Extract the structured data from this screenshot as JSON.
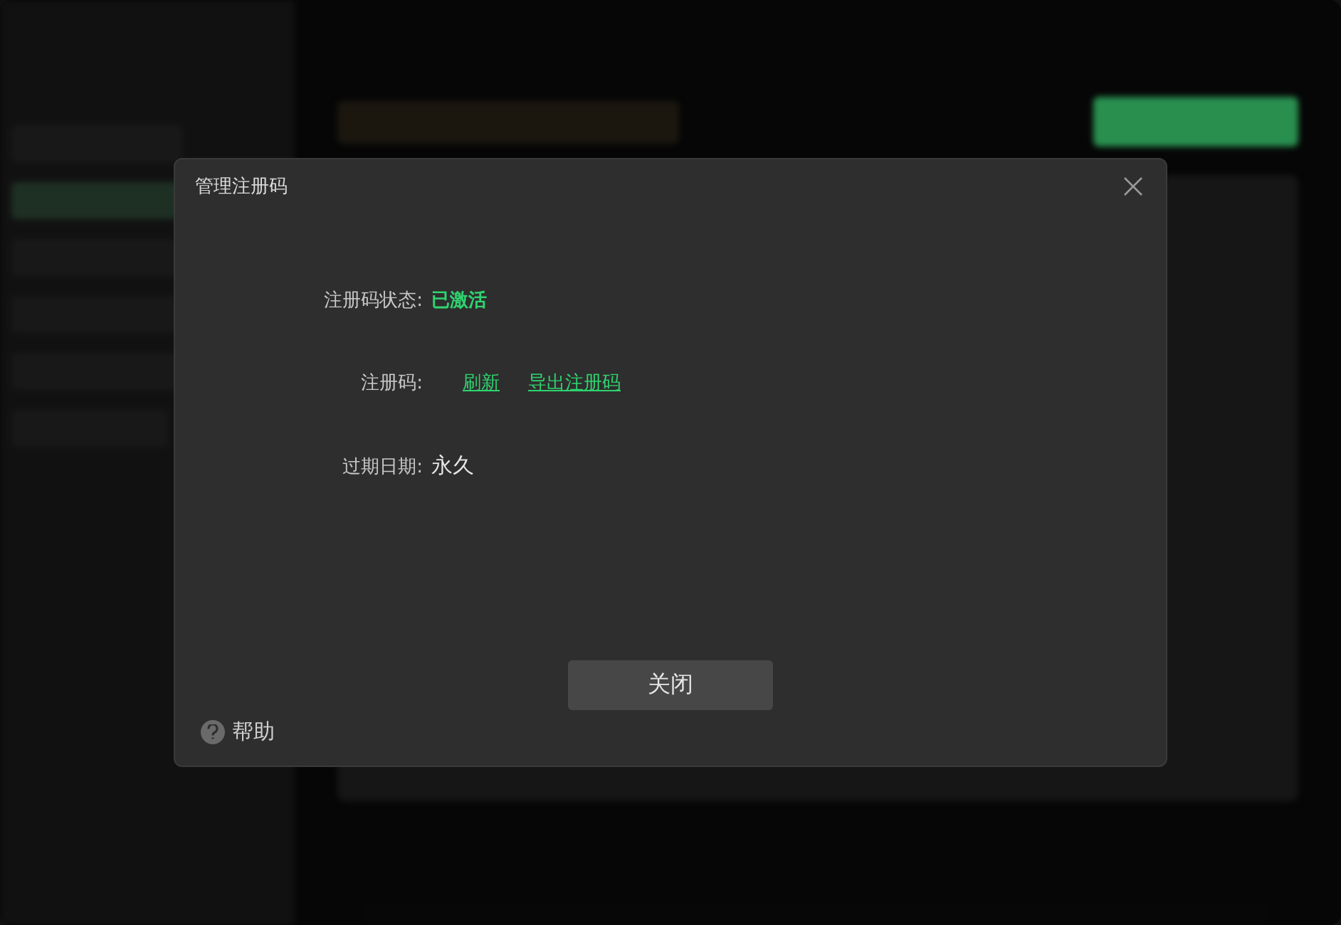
{
  "dialog": {
    "title": "管理注册码",
    "fields": [
      {
        "kind": "status",
        "label": "注册码状态:",
        "value": "已激活"
      },
      {
        "kind": "links",
        "label": "注册码:",
        "links": [
          "刷新",
          "导出注册码"
        ]
      },
      {
        "kind": "text",
        "label": "过期日期:",
        "value": "永久"
      }
    ],
    "close_button": "关闭",
    "help": "帮助"
  }
}
